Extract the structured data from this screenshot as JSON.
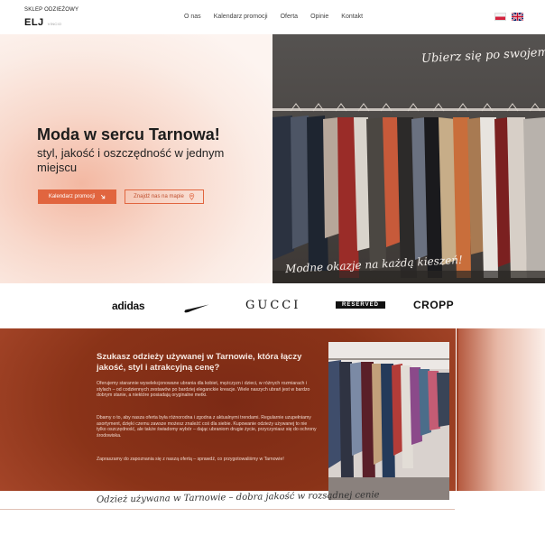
{
  "header": {
    "logo_top": "SKLEP ODZIEŻOWY",
    "logo_main": "ELJ",
    "logo_sub": "VINCIO",
    "nav": [
      "O nas",
      "Kalendarz promocji",
      "Oferta",
      "Opinie",
      "Kontakt"
    ],
    "flags": [
      "pl-flag-icon",
      "uk-flag-icon"
    ]
  },
  "hero": {
    "title": "Moda w sercu Tarnowa!",
    "subtitle": "styl, jakość i oszczędność w jednym miejscu",
    "primary_button": "Kalendarz promocji",
    "secondary_button": "Znajdź nas na mapie",
    "script_top": "Ubierz się po swojemu!",
    "script_bottom": "Modne okazje na każdą kieszeń!"
  },
  "brands": [
    "adidas",
    "nike-logo",
    "GUCCI",
    "RESERVED",
    "CROPP"
  ],
  "info": {
    "title": "Szukasz odzieży używanej w Tarnowie, która łączy jakość, styl i atrakcyjną cenę?",
    "p1": "Oferujemy starannie wyselekcjonowane ubrania dla kobiet, mężczyzn i dzieci, w różnych rozmiarach i stylach – od codziennych zestawów po bardziej eleganckie kreacje. Wiele naszych ubrań jest w bardzo dobrym stanie, a niektóre posiadają oryginalne metki.",
    "p2": "Dbamy o to, aby nasza oferta była różnorodna i zgodna z aktualnymi trendami. Regularnie uzupełniamy asortyment, dzięki czemu zawsze możesz znaleźć coś dla siebie. Kupowanie odzieży używanej to nie tylko oszczędność, ale także świadomy wybór – dając ubraniom drugie życie, przyczyniasz się do ochrony środowiska.",
    "p3": "Zapraszamy do zapoznania się z naszą ofertą – sprawdź, co przygotowaliśmy w Tarnowie!",
    "script": "Odzież używana w Tarnowie – dobra jakość w rozsądnej cenie"
  },
  "colors": {
    "accent": "#e1653f",
    "info_bg": "#8a3318"
  }
}
